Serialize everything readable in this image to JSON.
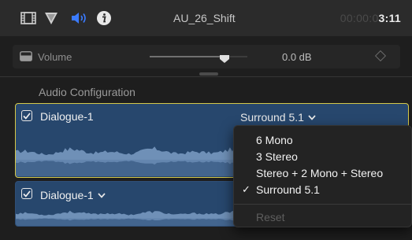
{
  "header": {
    "clip_title": "AU_26_Shift",
    "timecode_dim": "00:00:0",
    "timecode_bright": "3:11",
    "icons": [
      "film-icon",
      "filter-icon",
      "speaker-icon",
      "info-icon"
    ],
    "active_color": "#3b7bff"
  },
  "volume": {
    "label": "Volume",
    "value": "0.0 dB",
    "slider_level": 0.75
  },
  "audio_config": {
    "section_label": "Audio Configuration",
    "selection_color": "#d4c84a",
    "clips": [
      {
        "name": "Dialogue-1",
        "checked": true,
        "configuration": "Surround 5.1"
      },
      {
        "name": "Dialogue-1",
        "checked": true
      }
    ]
  },
  "menu": {
    "items": [
      "6 Mono",
      "3 Stereo",
      "Stereo + 2 Mono + Stereo",
      "Surround 5.1"
    ],
    "selected": "Surround 5.1",
    "reset": "Reset"
  }
}
